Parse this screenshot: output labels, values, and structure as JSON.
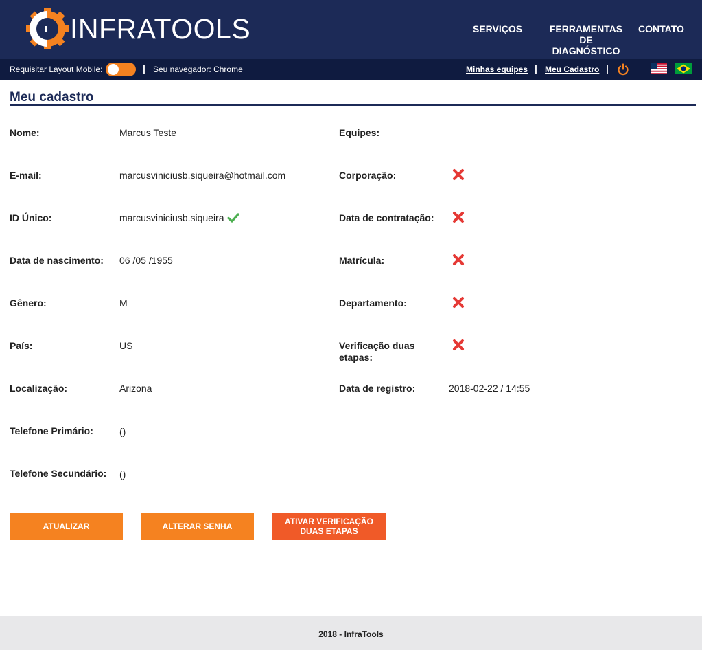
{
  "header": {
    "logo_text": "INFRATOOLS",
    "nav": {
      "servicos": "SERVIÇOS",
      "ferramentas_line1": "FERRAMENTAS",
      "ferramentas_line2": "DE",
      "ferramentas_line3": "DIAGNÓSTICO",
      "contato": "CONTATO"
    },
    "colors": {
      "primary": "#1c2a57",
      "accent": "#f58220"
    }
  },
  "subbar": {
    "mobile_label": "Requisitar Layout Mobile:",
    "browser_label": "Seu navegador: Chrome",
    "separator": "|",
    "minhas_equipes": "Minhas equipes",
    "meu_cadastro": "Meu Cadastro",
    "power_icon": "power-icon",
    "flags": [
      "us-flag",
      "brazil-flag"
    ]
  },
  "page": {
    "title": "Meu cadastro"
  },
  "left_fields": [
    {
      "label": "Nome:",
      "value": "Marcus Teste"
    },
    {
      "label": "E-mail:",
      "value": "marcusviniciusb.siqueira@hotmail.com"
    },
    {
      "label": "ID Único:",
      "value": "marcusviniciusb.siqueira"
    },
    {
      "label": "Data de nascimento:",
      "value": "06 /05 /1955"
    },
    {
      "label": "Gênero:",
      "value": "M"
    },
    {
      "label": "País:",
      "value": "US"
    },
    {
      "label": "Localização:",
      "value": "Arizona"
    },
    {
      "label": "Telefone Primário:",
      "value": "()"
    },
    {
      "label": "Telefone Secundário:",
      "value": "()"
    }
  ],
  "right_fields": [
    {
      "label": "Equipes:",
      "value": ""
    },
    {
      "label": "Corporação:",
      "status": "x-icon"
    },
    {
      "label": "Data de contratação:",
      "status": "x-icon"
    },
    {
      "label": "Matrícula:",
      "status": "x-icon"
    },
    {
      "label": "Departamento:",
      "status": "x-icon"
    },
    {
      "label_line1": "Verificação duas",
      "label_line2": "etapas:",
      "status": "x-icon"
    },
    {
      "label": "Data de registro:",
      "value": "2018-02-22 / 14:55"
    }
  ],
  "buttons": {
    "atualizar": "ATUALIZAR",
    "alterar_senha": "ALTERAR SENHA",
    "ativar_line1": "ATIVAR VERIFICAÇÃO",
    "ativar_line2": "DUAS ETAPAS"
  },
  "footer": {
    "text": "2018 - InfraTools"
  }
}
